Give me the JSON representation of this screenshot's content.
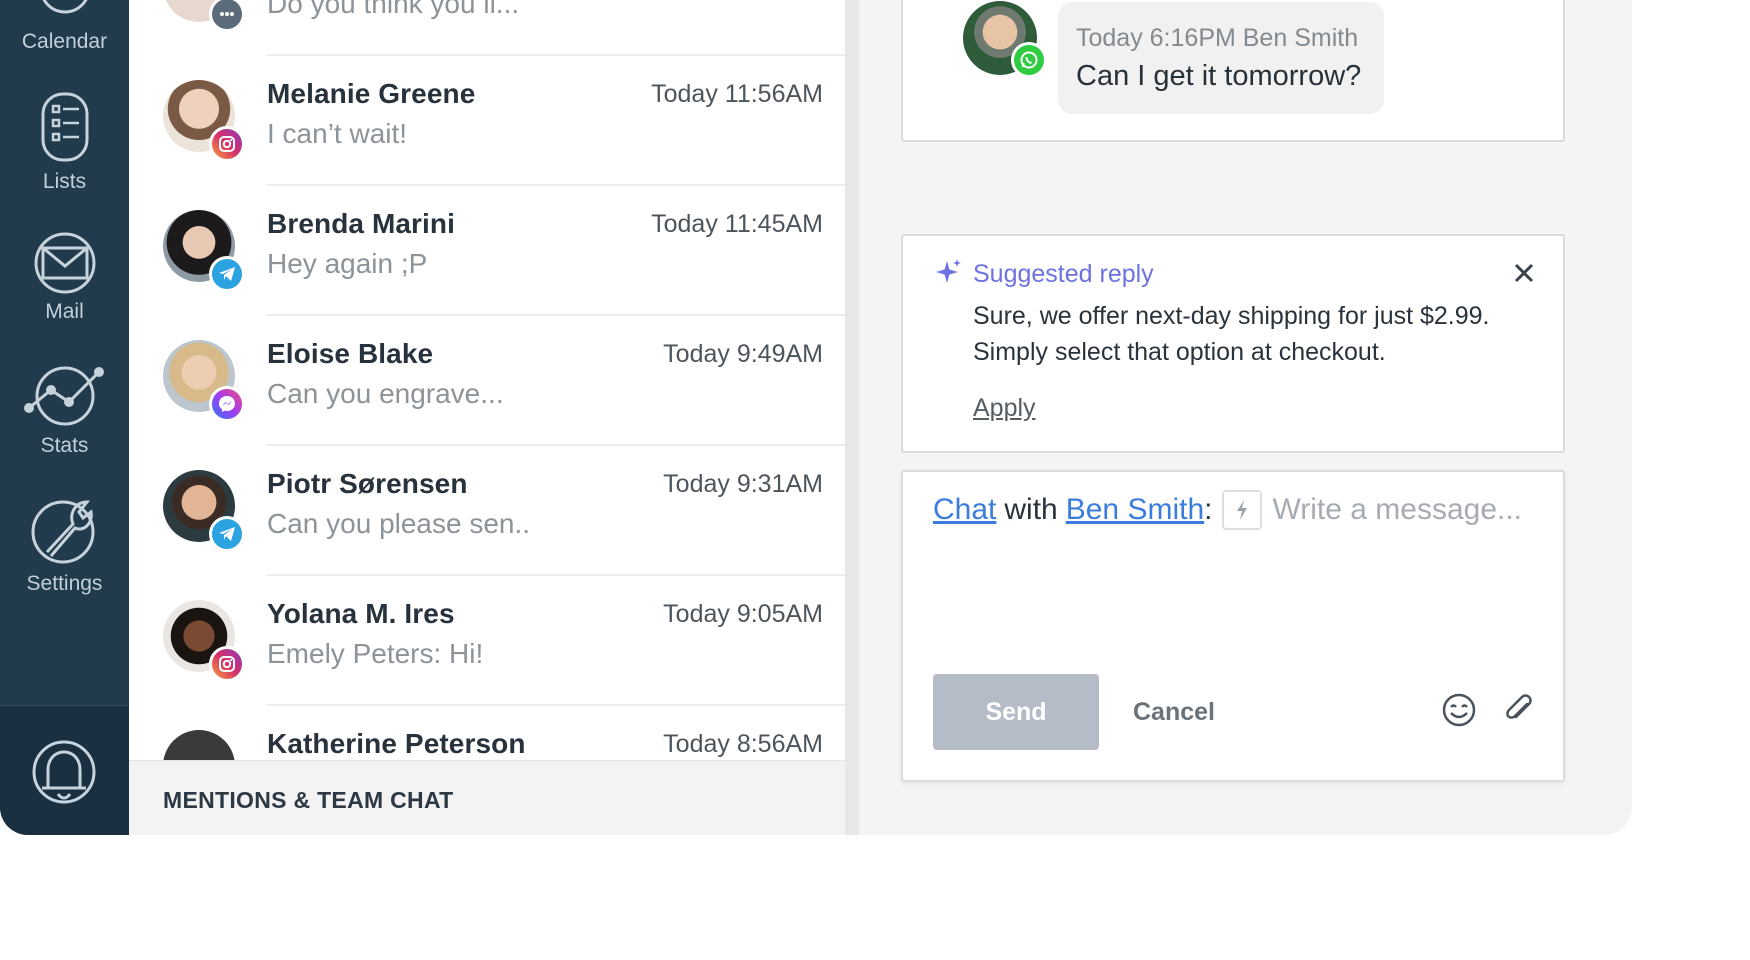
{
  "sidebar": {
    "items": [
      {
        "label": "Calendar",
        "icon": "calendar-icon"
      },
      {
        "label": "Lists",
        "icon": "list-icon"
      },
      {
        "label": "Mail",
        "icon": "mail-icon"
      },
      {
        "label": "Stats",
        "icon": "stats-icon"
      },
      {
        "label": "Settings",
        "icon": "settings-icon"
      }
    ],
    "bottom_icon": "bell-icon"
  },
  "conversations": [
    {
      "name": "",
      "preview": "Do you think you ll...",
      "time": "",
      "channel": "chat"
    },
    {
      "name": "Melanie Greene",
      "preview": "I can’t wait!",
      "time": "Today 11:56AM",
      "channel": "instagram"
    },
    {
      "name": "Brenda Marini",
      "preview": "Hey again ;P",
      "time": "Today 11:45AM",
      "channel": "telegram"
    },
    {
      "name": "Eloise Blake",
      "preview": "Can you engrave...",
      "time": "Today 9:49AM",
      "channel": "messenger"
    },
    {
      "name": "Piotr Sørensen",
      "preview": "Can you please sen..",
      "time": "Today 9:31AM",
      "channel": "telegram"
    },
    {
      "name": "Yolana M. Ires",
      "preview": "Emely Peters: Hi!",
      "time": "Today 9:05AM",
      "channel": "instagram"
    },
    {
      "name": "Katherine Peterson",
      "preview": "",
      "time": "Today 8:56AM",
      "channel": ""
    }
  ],
  "list_footer": "MENTIONS & TEAM CHAT",
  "message": {
    "meta": "Today 6:16PM Ben Smith",
    "text": "Can I get it tomorrow?",
    "channel": "whatsapp"
  },
  "suggestion": {
    "title": "Suggested reply",
    "line1": "Sure, we offer next-day shipping for just $2.99.",
    "line2": "Simply select that option at checkout.",
    "apply": "Apply"
  },
  "composer": {
    "chat_label": "Chat",
    "with": "with",
    "contact": "Ben Smith",
    "colon": ":",
    "placeholder": "Write a message...",
    "send": "Send",
    "cancel": "Cancel"
  },
  "colors": {
    "sidebar": "#213a4c",
    "accent_link": "#3b7ddc",
    "suggest": "#6d72e0",
    "send_disabled": "#b4bcc8",
    "instagram": "#d6306a",
    "telegram": "#2aa3e0",
    "messenger": "#8b52f0",
    "whatsapp": "#2ecc40"
  }
}
